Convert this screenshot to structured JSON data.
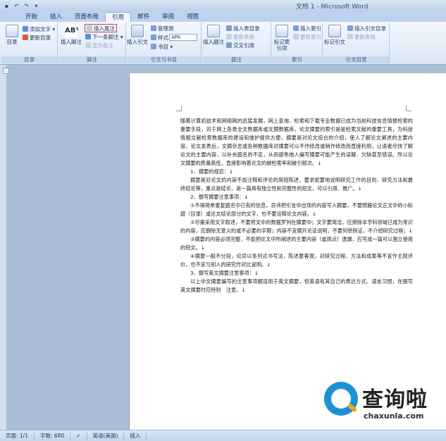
{
  "window": {
    "title": "文档 1 - Microsoft Word"
  },
  "quick_access": [
    {
      "name": "save-icon",
      "glyph": "▪"
    },
    {
      "name": "undo-icon",
      "glyph": "↶"
    },
    {
      "name": "redo-icon",
      "glyph": "↷"
    },
    {
      "name": "customize-icon",
      "glyph": "▾"
    }
  ],
  "tabs": [
    {
      "label": "开始",
      "active": false
    },
    {
      "label": "插入",
      "active": false
    },
    {
      "label": "页面布局",
      "active": false
    },
    {
      "label": "引用",
      "active": true
    },
    {
      "label": "邮件",
      "active": false
    },
    {
      "label": "审阅",
      "active": false
    },
    {
      "label": "视图",
      "active": false
    }
  ],
  "ribbon": {
    "toc": {
      "label": "目录",
      "big": "目录",
      "add_text": "添加文字 ▾",
      "update_toc": "更新目录"
    },
    "footnotes": {
      "label": "脚注",
      "big": "插入脚注",
      "insert_endnote": "插入尾注",
      "next_footnote": "下一条脚注 ▾",
      "show_notes": "显示备注"
    },
    "citations": {
      "label": "引文与书目",
      "big": "插入引文",
      "manage_sources": "管理源",
      "style_label": "样式:",
      "style_value": "APA",
      "bibliography": "书目 ▾"
    },
    "captions": {
      "label": "题注",
      "big": "插入题注",
      "insert_tof": "插入表目录",
      "update_table": "更新表格",
      "cross_ref": "交叉引用"
    },
    "index": {
      "label": "索引",
      "big": "标记索引项",
      "insert_index": "插入索引",
      "update_index": "更新索引"
    },
    "toa": {
      "label": "引文目录",
      "big": "标记引文",
      "insert_toa": "插入引文目录",
      "update_toa": "更新表格"
    }
  },
  "document": {
    "paragraphs": [
      {
        "text": "随着计算机技术和网络网的迅猛发展，网上查询、检索和下载专业数据已成为当前科技信息情报检索的重要手段，对于网上各类全文数据库或文摘数据库，论文摘要的索引是是检索文献的重要工具，为科技情报文献检索数据库的建设和维护提供方便，摘要是对论文综合的介绍，使人了解论文阐述的主要内容，论文发表后，文摘杂志或各种数据库对摘要可以不作修改或稍作修改而直接利用，让读者尽快了解论文的主要内容，以补充题名的不足，从而避免他人编写摘要可能产生的误解、欠缺甚至错误。所以论文摘要的质量高低，直接影响着论文的被检索率和被引频次。↓",
        "indent": false
      },
      {
        "text": "1、摘要的规范：↓",
        "indent": true
      },
      {
        "text": "摘要是对论文的内容不加注释和评论的简短陈述，要求扼要地说明研究工作的目的、研究方法和最终结论等，重点是结论，是一篇具有独立性和完整性的短文，可以引用、推广。↓",
        "indent": true
      },
      {
        "text": "2、撰写摘要注意事项：↓",
        "indent": true
      },
      {
        "text": "①不得简单重复题名中已有的信息，忌讳把引言中出现的内容写入摘要，不要照搬论文正文中的小标题（目录）或论文结论部分的文字，也不要诠释论文内容。↓",
        "indent": true
      },
      {
        "text": "②尽量采用文字叙述，不要将文中的数据罗列在摘要中；文字要简洁，应排除本学科领域已成为常识的内容，应删除无意义的或不必要的字眼；内容不宜展开论证说明，不要列举例证，不介绍研究过程；↓",
        "indent": true
      },
      {
        "text": "③摘要的内容必须完整，不能把论文中所阐述的主要内容（或观点）遗漏，应写成一篇可以独立使用的短文。↓",
        "indent": true
      },
      {
        "text": "④摘要一般不分段，切忌以条列式书写法，陈述要客观，对研究过程、方法和成果等不宜作主观评价，也不宜与别人的研究作对比说明。↓",
        "indent": true
      },
      {
        "text": "3、撰写英文摘要注意事项：↓",
        "indent": true
      },
      {
        "text": "以上中文摘要编写的注意事项都适用于英文摘要，但英语有其自己的表达方式、语言习惯，在撰写英文摘要时应特别　注意。↓",
        "indent": true
      }
    ]
  },
  "watermark": {
    "title": "查询啦",
    "url": "chaxunla.com"
  },
  "statusbar": {
    "page": "页面: 1/1",
    "words": "字数: 680",
    "language": "英语(美国)",
    "mode": "插入"
  },
  "colors": {
    "accent_red": "#d83c3c",
    "logo_blue": "#1e90d8",
    "logo_orange": "#f4a21f"
  }
}
